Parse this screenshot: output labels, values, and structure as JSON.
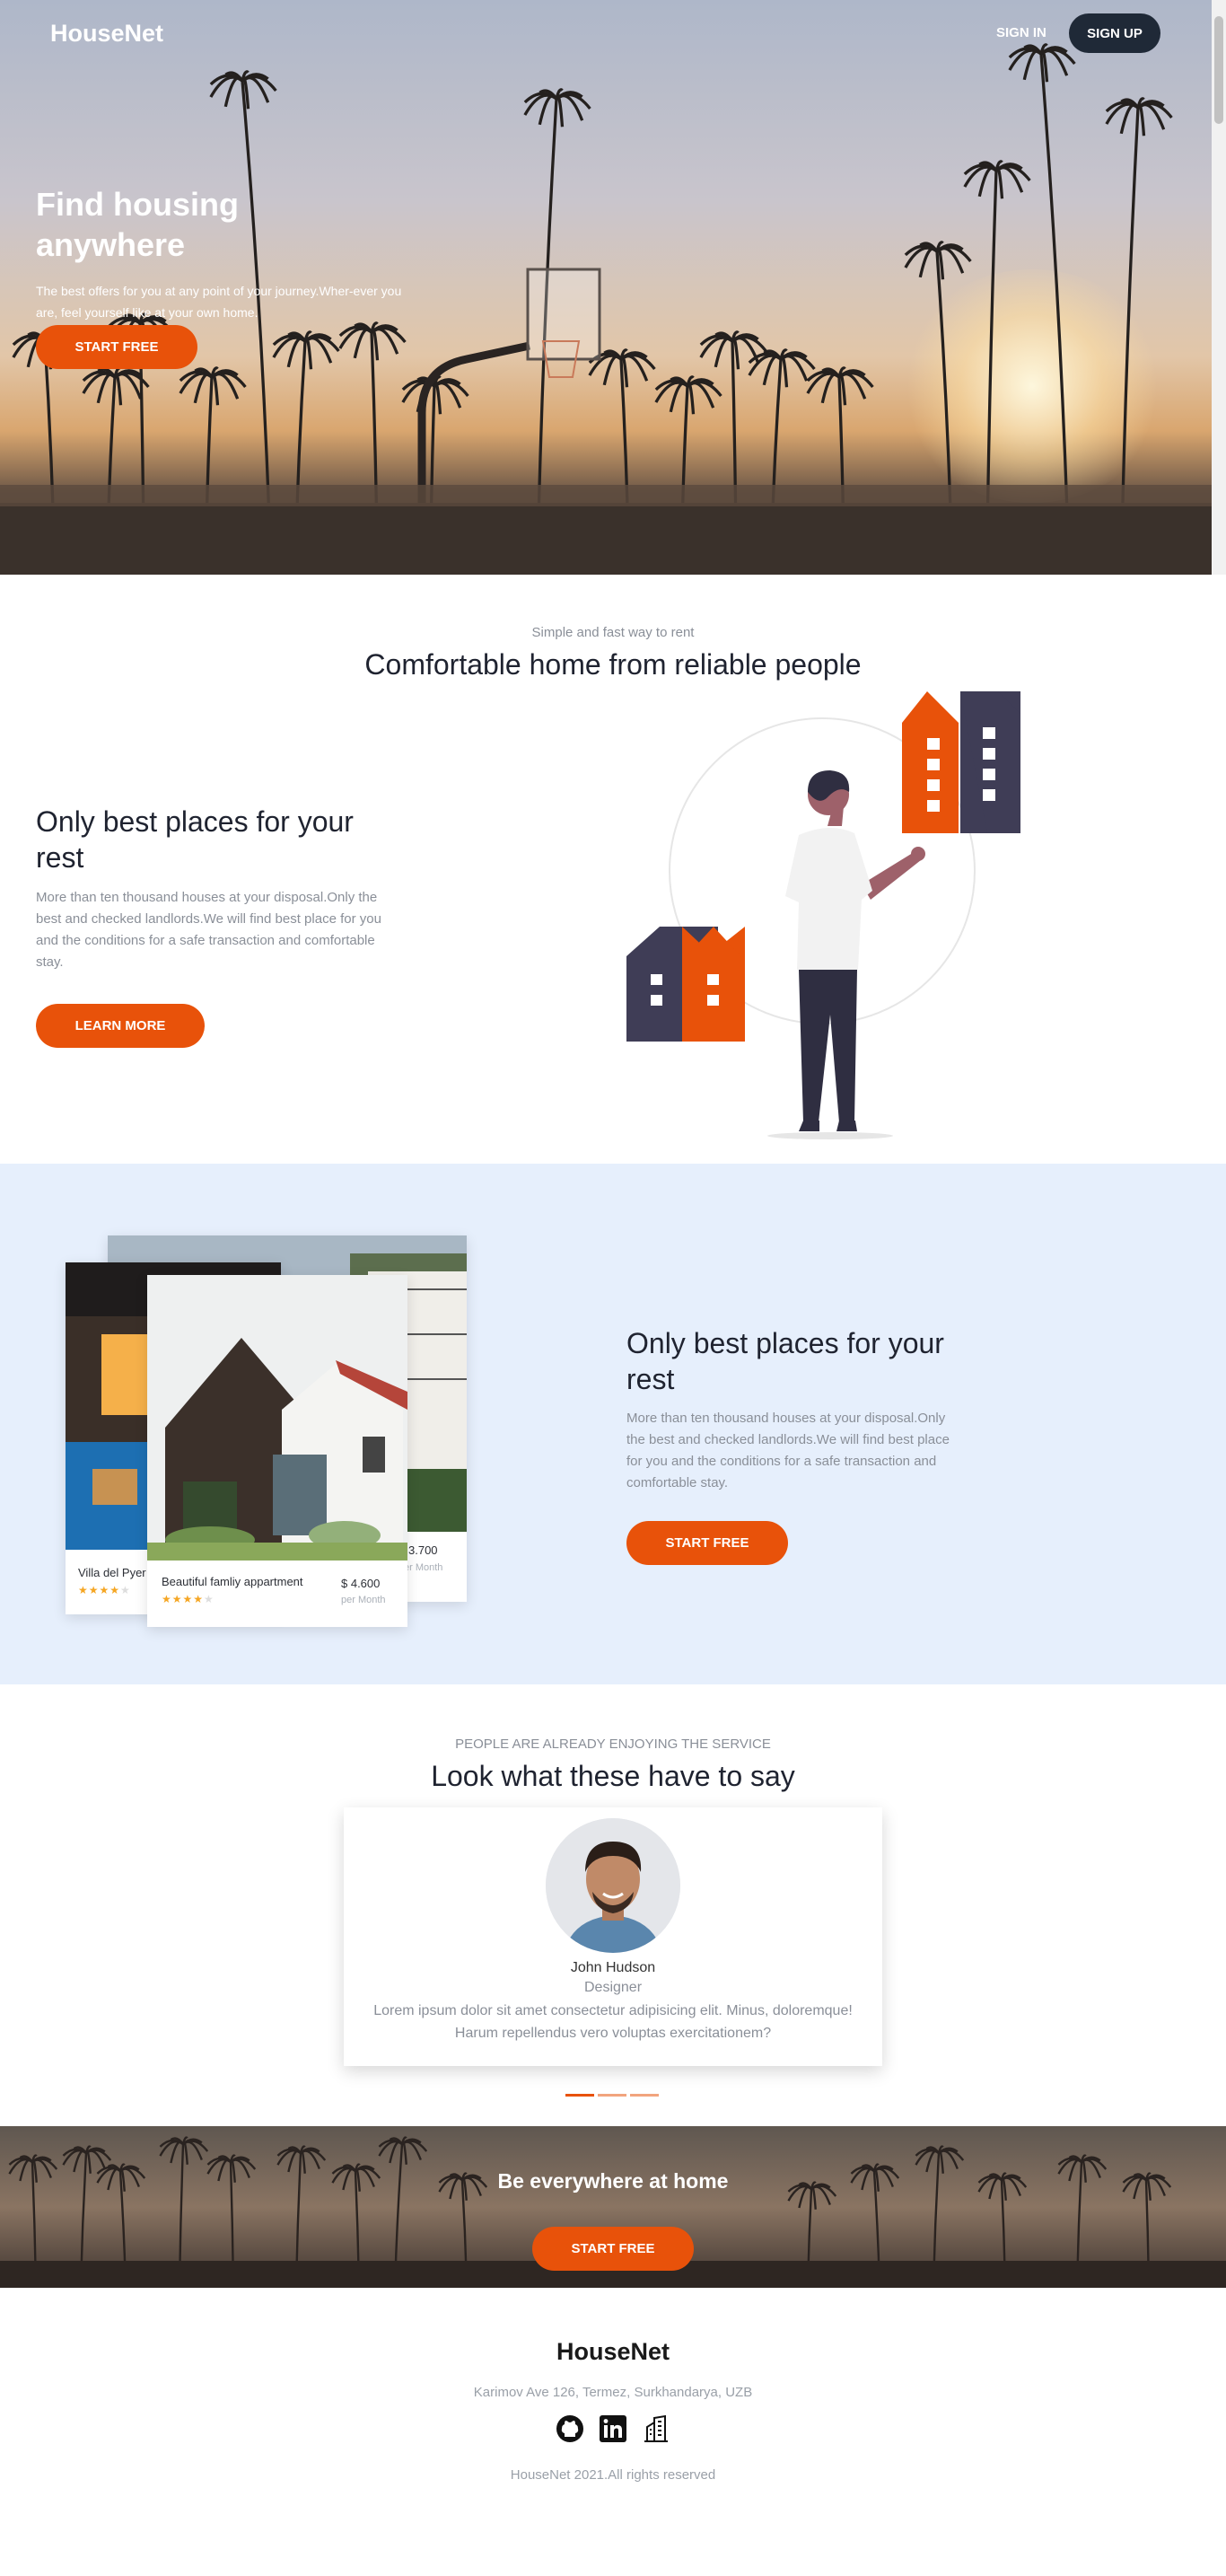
{
  "colors": {
    "accent": "#e8520a",
    "dark": "#1f2937",
    "light_blue_bg": "#e6effc",
    "muted_text": "#8a8f98"
  },
  "nav": {
    "logo": "HouseNet",
    "sign_in": "SIGN IN",
    "sign_up": "SIGN UP"
  },
  "hero": {
    "title": "Find housing anywhere",
    "text": "The best offers for you at any point of your journey.Wher-ever you are, feel yourself like at your own home.",
    "button": "START FREE"
  },
  "intro": {
    "subtitle": "Simple and fast way to rent",
    "title": "Comfortable home from reliable people",
    "heading": "Only best places for your rest",
    "text": "More than ten thousand houses at your disposal.Only the best and checked landlords.We will find best place for you and the conditions for a safe transaction and comfortable stay.",
    "button": "LEARN MORE"
  },
  "listings": {
    "heading": "Only best places for your rest",
    "text": "More than ten thousand houses at your disposal.Only the best and checked landlords.We will find best place for you and the conditions for a safe transaction and comfortable stay.",
    "button": "START FREE",
    "cards": [
      {
        "name": "Villa del Pyer",
        "rating": 4
      },
      {
        "price": "3.700",
        "per": "er Month"
      },
      {
        "name": "Beautiful famliy appartment",
        "price": "$ 4.600",
        "per": "per Month",
        "rating": 4
      }
    ]
  },
  "testimonials": {
    "subtitle": "PEOPLE ARE ALREADY ENJOYING THE SERVICE",
    "title": "Look what these have to say",
    "name": "John Hudson",
    "role": "Designer",
    "quote": "Lorem ipsum dolor sit amet consectetur adipisicing elit. Minus, doloremque! Harum repellendus vero voluptas exercitationem?",
    "slides": 3,
    "active_slide": 1
  },
  "cta": {
    "title": "Be everywhere at home",
    "button": "START FREE"
  },
  "footer": {
    "brand": "HouseNet",
    "address": "Karimov Ave 126, Termez, Surkhandarya, UZB",
    "icons": [
      "github-icon",
      "linkedin-icon",
      "building-icon"
    ],
    "copyright": "HouseNet 2021.All rights reserved"
  }
}
